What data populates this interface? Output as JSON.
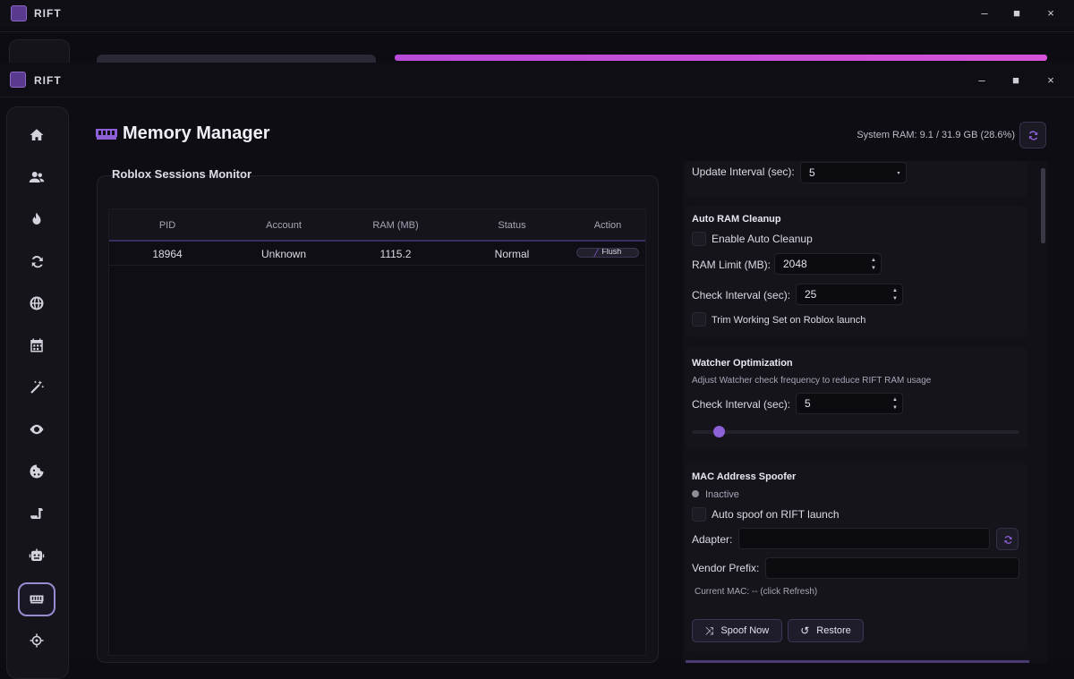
{
  "back_window": {
    "title": "RIFT"
  },
  "window": {
    "title": "RIFT",
    "minimize": "•",
    "maximize": "■",
    "close": "×"
  },
  "page": {
    "title": "Memory Manager",
    "system_ram": "System RAM: 9.1 / 31.9 GB (28.6%)"
  },
  "sidebar": {
    "items": [
      {
        "icon": "home-icon"
      },
      {
        "icon": "users-icon"
      },
      {
        "icon": "fire-icon"
      },
      {
        "icon": "sync-icon"
      },
      {
        "icon": "globe-icon"
      },
      {
        "icon": "calendar-icon"
      },
      {
        "icon": "magic-wand-icon"
      },
      {
        "icon": "eye-icon"
      },
      {
        "icon": "cookie-icon"
      },
      {
        "icon": "scroll-icon"
      },
      {
        "icon": "robot-icon"
      },
      {
        "icon": "memory-icon",
        "active": true
      },
      {
        "icon": "crosshair-icon"
      }
    ]
  },
  "sessions": {
    "title": "Roblox Sessions Monitor",
    "columns": [
      "PID",
      "Account",
      "RAM (MB)",
      "Status",
      "Action"
    ],
    "rows": [
      {
        "pid": "18964",
        "account": "Unknown",
        "ram": "1115.2",
        "status": "Normal",
        "action": "Flush"
      }
    ]
  },
  "settings": {
    "update_interval_label": "Update Interval (sec):",
    "update_interval_value": "5",
    "auto_cleanup": {
      "title": "Auto RAM Cleanup",
      "enable_label": "Enable Auto Cleanup",
      "ram_limit_label": "RAM Limit (MB):",
      "ram_limit_value": "2048",
      "check_interval_label": "Check Interval (sec):",
      "check_interval_value": "25",
      "trim_label": "Trim Working Set on Roblox launch"
    },
    "watcher": {
      "title": "Watcher Optimization",
      "subtitle": "Adjust Watcher check frequency to reduce RIFT RAM usage",
      "check_interval_label": "Check Interval (sec):",
      "check_interval_value": "5",
      "slider_fraction": 0.08
    },
    "mac": {
      "title": "MAC Address Spoofer",
      "status": "Inactive",
      "auto_spoof_label": "Auto spoof on RIFT launch",
      "adapter_label": "Adapter:",
      "vendor_label": "Vendor Prefix:",
      "current_mac": "Current MAC: -- (click Refresh)",
      "spoof_button": "Spoof Now",
      "restore_button": "Restore"
    }
  },
  "colors": {
    "accent": "#8d60d8",
    "progress_gradient_start": "#b94bd9",
    "progress_gradient_end": "#d553d8"
  }
}
